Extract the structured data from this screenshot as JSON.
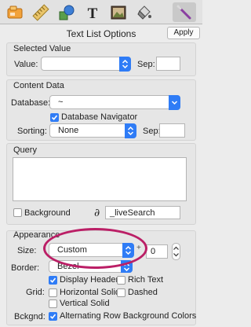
{
  "toolbar": {
    "tools": [
      {
        "name": "card-icon",
        "active": false
      },
      {
        "name": "ruler-icon",
        "active": false
      },
      {
        "name": "shapes-icon",
        "active": false
      },
      {
        "name": "text-tool-icon",
        "label": "T",
        "active": false
      },
      {
        "name": "image-icon",
        "active": false
      },
      {
        "name": "paint-bucket-icon",
        "active": false
      },
      {
        "name": "magic-wand-icon",
        "active": true
      }
    ]
  },
  "panel": {
    "title": "Text List Options",
    "apply_label": "Apply"
  },
  "selected_value": {
    "heading": "Selected Value",
    "value_label": "Value:",
    "value": "",
    "sep_label": "Sep:",
    "sep": ""
  },
  "content_data": {
    "heading": "Content Data",
    "database_label": "Database:",
    "database_value": "~",
    "navigator_label": "Database Navigator",
    "navigator_checked": true,
    "sorting_label": "Sorting:",
    "sorting_value": "None",
    "sep_label": "Sep:",
    "sep": ""
  },
  "query": {
    "heading": "Query",
    "query_text": "",
    "background_label": "Background",
    "background_checked": false,
    "script_icon_glyph": "∂",
    "script_value": "_liveSearch"
  },
  "appearance": {
    "heading": "Appearance",
    "size_label": "Size:",
    "size_value": "Custom",
    "plus_glyph": "+",
    "size_number": "0",
    "border_label": "Border:",
    "border_value": "Bezel",
    "display_header_label": "Display Header",
    "display_header_checked": true,
    "rich_text_label": "Rich Text",
    "rich_text_checked": false,
    "grid_label": "Grid:",
    "horizontal_solid_label": "Horizontal Solid",
    "horizontal_solid_checked": false,
    "dashed_label": "Dashed",
    "dashed_checked": false,
    "vertical_solid_label": "Vertical Solid",
    "vertical_solid_checked": false,
    "bckgnd_label": "Bckgnd:",
    "alternating_label": "Alternating Row Background Colors",
    "alternating_checked": true
  },
  "colors": {
    "accent": "#2f7cf6",
    "annotation": "#bb1f66"
  }
}
